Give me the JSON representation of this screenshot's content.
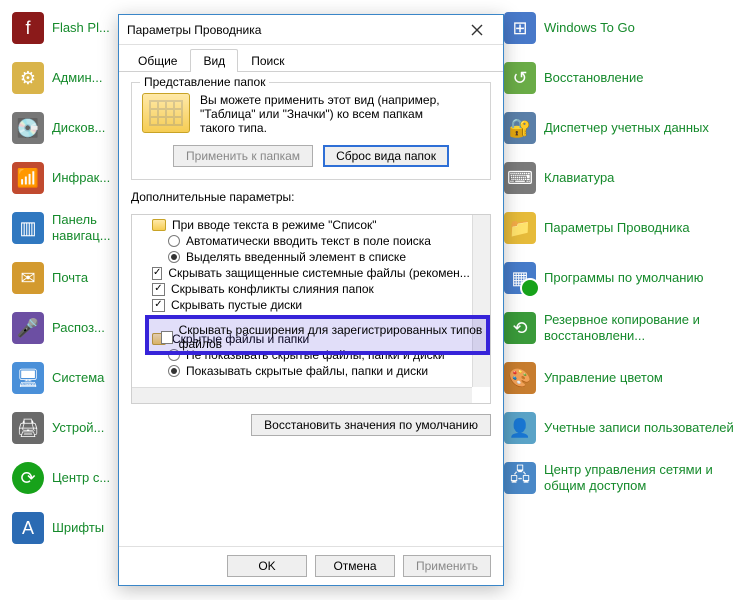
{
  "left_items": [
    {
      "label": "Flash Pl..."
    },
    {
      "label": "Админ..."
    },
    {
      "label": "Дисков..."
    },
    {
      "label": "Инфрак..."
    },
    {
      "label": "Панель навигац..."
    },
    {
      "label": "Почта"
    },
    {
      "label": "Распоз..."
    },
    {
      "label": "Система"
    },
    {
      "label": "Устрой..."
    },
    {
      "label": "Центр с..."
    },
    {
      "label": "Шрифты"
    }
  ],
  "right_items": [
    {
      "label": "Windows To Go"
    },
    {
      "label": "Восстановление"
    },
    {
      "label": "Диспетчер учетных данных"
    },
    {
      "label": "Клавиатура"
    },
    {
      "label": "Параметры Проводника"
    },
    {
      "label": "Программы по умолчанию"
    },
    {
      "label": "Резервное копирование и восстановлени..."
    },
    {
      "label": "Управление цветом"
    },
    {
      "label": "Учетные записи пользователей"
    },
    {
      "label": "Центр управления сетями и общим доступом"
    }
  ],
  "dialog": {
    "title": "Параметры Проводника",
    "tabs": {
      "general": "Общие",
      "view": "Вид",
      "search": "Поиск"
    },
    "group_title": "Представление папок",
    "group_text": "Вы можете применить этот вид (например, \"Таблица\" или \"Значки\") ко всем папкам такого типа.",
    "apply_folders": "Применить к папкам",
    "reset_folders": "Сброс вида папок",
    "adv_label": "Дополнительные параметры:",
    "restore_defaults": "Восстановить значения по умолчанию",
    "ok": "OK",
    "cancel": "Отмена",
    "apply": "Применить",
    "highlight": "Скрывать расширения для зарегистрированных типов файлов",
    "options": {
      "header": "При вводе текста в режиме \"Список\"",
      "opt_auto": "Автоматически вводить текст в поле поиска",
      "opt_select": "Выделять введенный элемент в списке",
      "hide_protected": "Скрывать защищенные системные файлы (рекомен...",
      "hide_merge": "Скрывать конфликты слияния папок",
      "hide_empty": "Скрывать пустые диски",
      "hidden_header": "Скрытые файлы и папки",
      "hidden_no": "Не показывать скрытые файлы, папки и диски",
      "hidden_yes": "Показывать скрытые файлы, папки и диски"
    }
  }
}
